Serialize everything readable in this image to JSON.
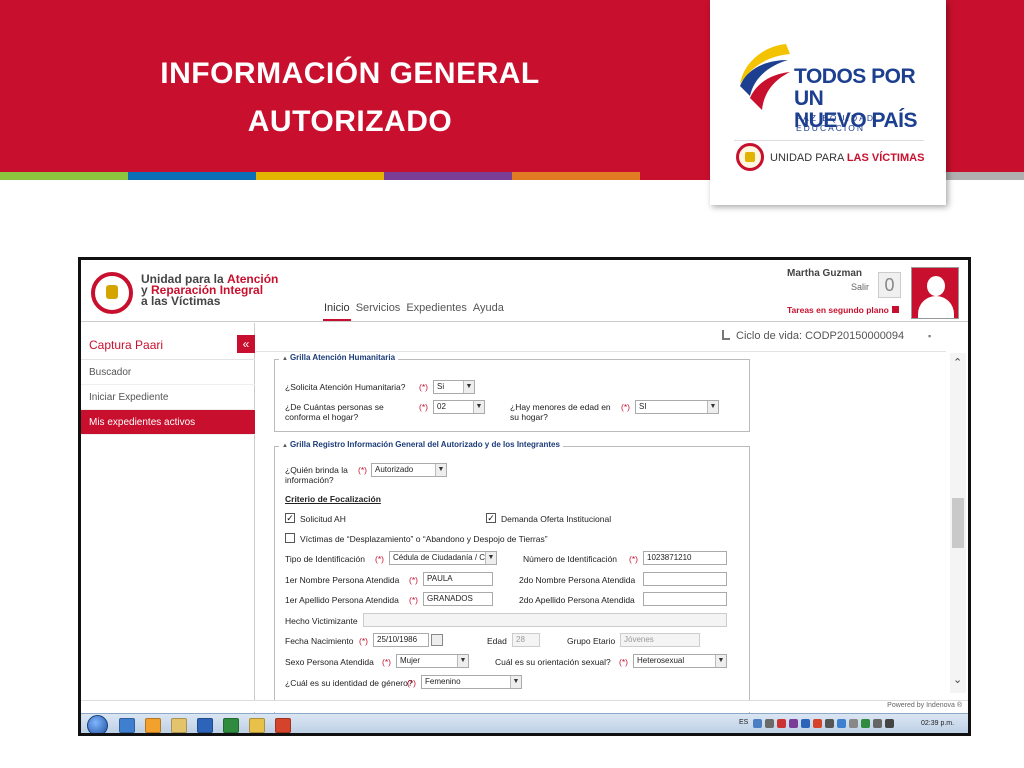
{
  "slide": {
    "title_line1": "INFORMACIÓN GENERAL",
    "title_line2": "AUTORIZADO",
    "colors": {
      "banner": "#c8102e",
      "stripe": [
        "#8cc63f",
        "#0b6fb8",
        "#e2b300",
        "#7a3e97",
        "#e07b24",
        "#c8102e",
        "#4db6ac",
        "#b0b0b0"
      ]
    }
  },
  "logo": {
    "line1": "TODOS POR UN",
    "line2": "NUEVO PAÍS",
    "tagline": "PAZ  EQUIDAD  EDUCACION",
    "unidad_prefix": "UNIDAD PARA ",
    "unidad_strong": "LAS VÍCTIMAS"
  },
  "app": {
    "name_l1_pre": "Unidad para la ",
    "name_l1_strong": "Atención",
    "name_l2_pre": "y ",
    "name_l2_strong": "Reparación Integral",
    "name_l3": "a las Víctimas",
    "nav": [
      "Inicio",
      "Servicios",
      "Expedientes",
      "Ayuda"
    ],
    "user": "Martha Guzman",
    "logout": "Salir",
    "notifications": "0",
    "tareas": "Tareas en segundo plano",
    "ciclo": "Ciclo de vida: CODP20150000094",
    "powered": "Powered by Indenova ®"
  },
  "sidebar": {
    "title": "Captura Paari",
    "collapse": "«",
    "items": [
      "Buscador",
      "Iniciar Expediente",
      "Mis expedientes activos"
    ]
  },
  "form": {
    "section1": {
      "legend": "Grilla Atención Humanitaria",
      "q1": "¿Solicita Atención Humanitaria?",
      "q1_value": "Si",
      "q2": "¿De Cuántas personas se conforma el hogar?",
      "q2_value": "02",
      "q3": "¿Hay menores de edad en su hogar?",
      "q3_value": "SI"
    },
    "section2": {
      "legend": "Grilla Registro Información General del Autorizado y de los Integrantes",
      "quien": "¿Quién brinda la información?",
      "quien_value": "Autorizado",
      "criterio": "Criterio de Focalización",
      "chk1": "Solicitud AH",
      "chk2": "Demanda Oferta Institucional",
      "chk3": "Víctimas de “Desplazamiento” o “Abandono y Despojo de Tierras”",
      "tipo_id": "Tipo de Identificación",
      "tipo_id_value": "Cédula de Ciudadanía / Cor",
      "num_id": "Número de Identificación",
      "num_id_value": "1023871210",
      "nombre1": "1er Nombre Persona Atendida",
      "nombre1_value": "PAULA",
      "nombre2": "2do Nombre Persona Atendida",
      "apellido1": "1er Apellido Persona Atendida",
      "apellido1_value": "GRANADOS",
      "apellido2": "2do Apellido Persona Atendida",
      "hecho": "Hecho Victimizante",
      "fecha": "Fecha Nacimiento",
      "fecha_value": "25/10/1986",
      "edad": "Edad",
      "edad_value": "28",
      "grupo": "Grupo Etario",
      "grupo_value": "Jóvenes",
      "sexo": "Sexo Persona Atendida",
      "sexo_value": "Mujer",
      "orientacion": "Cuál es su orientación sexual?",
      "orientacion_value": "Heterosexual",
      "identidad": "¿Cuál es su identidad de género?",
      "identidad_value": "Femenino",
      "req": "(*)"
    }
  },
  "taskbar": {
    "lang": "ES",
    "clock": "02:39 p.m."
  }
}
